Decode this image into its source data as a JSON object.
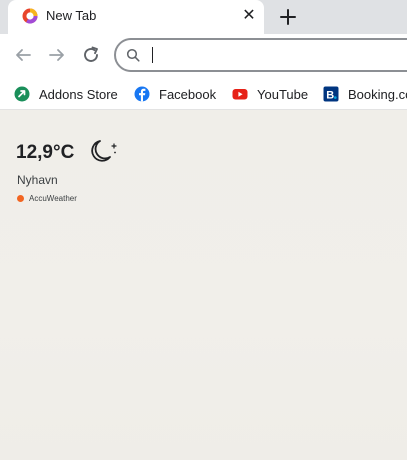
{
  "tab": {
    "title": "New Tab",
    "close_glyph": "✕"
  },
  "toolbar": {
    "omnibox_value": ""
  },
  "bookmarks": [
    {
      "label": "Addons Store",
      "icon": "addons-store-icon",
      "color": "#1a8f5a"
    },
    {
      "label": "Facebook",
      "icon": "facebook-icon",
      "color": "#1877f2"
    },
    {
      "label": "YouTube",
      "icon": "youtube-icon",
      "color": "#e62117"
    },
    {
      "label": "Booking.com",
      "icon": "booking-icon",
      "color": "#003580"
    }
  ],
  "weather": {
    "temperature": "12,9°C",
    "condition_icon": "moon-icon",
    "location": "Nyhavn",
    "provider": "AccuWeather",
    "provider_color": "#f26522"
  }
}
